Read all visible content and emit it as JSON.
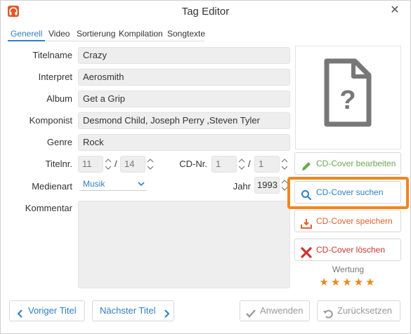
{
  "window": {
    "title": "Tag Editor",
    "close_glyph": "✕",
    "app_icon": "headphones-icon"
  },
  "tabs": [
    {
      "label": "Generell",
      "active": true
    },
    {
      "label": "Video"
    },
    {
      "label": "Sortierung"
    },
    {
      "label": "Kompilation"
    },
    {
      "label": "Songtexte"
    }
  ],
  "fields": {
    "titelname": {
      "label": "Titelname",
      "value": "Crazy"
    },
    "interpret": {
      "label": "Interpret",
      "value": "Aerosmith"
    },
    "album": {
      "label": "Album",
      "value": "Get a Grip"
    },
    "komponist": {
      "label": "Komponist",
      "value": "Desmond Child, Joseph Perry ,Steven Tyler"
    },
    "genre": {
      "label": "Genre",
      "value": "Rock"
    },
    "titelnr": {
      "label": "Titelnr.",
      "value": "11",
      "total": "14",
      "separator": "/"
    },
    "cdnr": {
      "label": "CD-Nr.",
      "value": "1",
      "total": "1",
      "separator": "/"
    },
    "medienart": {
      "label": "Medienart",
      "value": "Musik"
    },
    "jahr": {
      "label": "Jahr",
      "value": "1993"
    },
    "kommentar": {
      "label": "Kommentar",
      "value": ""
    }
  },
  "cover_buttons": {
    "edit": {
      "label": "CD-Cover bearbeiten",
      "color": "#6aa84f",
      "icon": "pencil-icon"
    },
    "search": {
      "label": "CD-Cover suchen",
      "color": "#2f7fc4",
      "icon": "search-icon"
    },
    "save": {
      "label": "CD-Cover speichern",
      "color": "#e0622a",
      "icon": "download-tray-icon"
    },
    "delete": {
      "label": "CD-Cover löschen",
      "color": "#cc3333",
      "icon": "close-icon"
    }
  },
  "rating": {
    "label": "Wertung",
    "stars": 5,
    "glyph": "★"
  },
  "bottom": {
    "prev": "Voriger Titel",
    "next": "Nächster Titel",
    "apply": "Anwenden",
    "reset": "Zurücksetzen"
  },
  "colors": {
    "accent": "#2f7fc4",
    "focus": "#f0861e",
    "star": "#e68a1e",
    "disabled": "#999999"
  }
}
